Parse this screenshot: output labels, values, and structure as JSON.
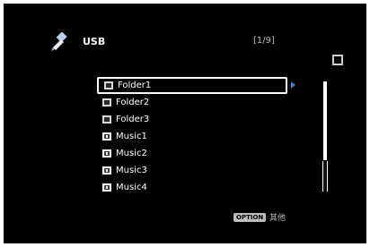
{
  "header": {
    "source_icon": "usb-plug-icon",
    "source_label": "USB",
    "page_indicator": "[1/9]"
  },
  "list": {
    "items": [
      {
        "label": "Folder1",
        "type": "folder",
        "icon": "folder-icon",
        "selected": true
      },
      {
        "label": "Folder2",
        "type": "folder",
        "icon": "folder-icon",
        "selected": false
      },
      {
        "label": "Folder3",
        "type": "folder",
        "icon": "folder-icon",
        "selected": false
      },
      {
        "label": "Music1",
        "type": "music",
        "icon": "music-file-icon",
        "selected": false
      },
      {
        "label": "Music2",
        "type": "music",
        "icon": "music-file-icon",
        "selected": false
      },
      {
        "label": "Music3",
        "type": "music",
        "icon": "music-file-icon",
        "selected": false
      },
      {
        "label": "Music4",
        "type": "music",
        "icon": "music-file-icon",
        "selected": false
      }
    ]
  },
  "footer": {
    "option_badge": "OPTION",
    "option_label": "其他"
  },
  "colors": {
    "background": "#000000",
    "text": "#ffffff",
    "selection_arrow": "#4a78c8"
  }
}
